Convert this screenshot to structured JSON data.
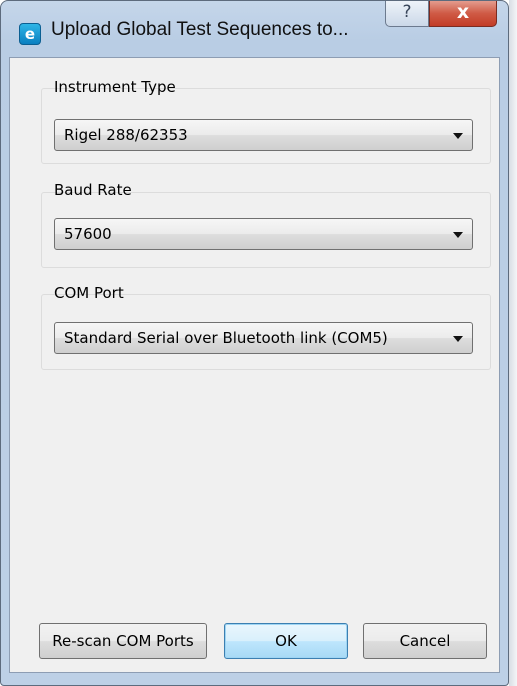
{
  "window": {
    "title": "Upload Global Test Sequences to...",
    "help_glyph": "?",
    "close_glyph": "x",
    "app_icon_glyph": "e",
    "app_icon": "app-logo-icon"
  },
  "groups": {
    "instrument_type": {
      "label": "Instrument Type",
      "selected": "Rigel 288/62353"
    },
    "baud_rate": {
      "label": "Baud Rate",
      "selected": "57600"
    },
    "com_port": {
      "label": "COM Port",
      "selected": "Standard Serial over Bluetooth link (COM5)"
    }
  },
  "buttons": {
    "rescan": "Re-scan COM Ports",
    "ok": "OK",
    "cancel": "Cancel"
  },
  "colors": {
    "titlebar": "#bdd0e6",
    "close_button": "#c23c26",
    "client_bg": "#f0f0f0",
    "default_button": "#bee6fd"
  }
}
